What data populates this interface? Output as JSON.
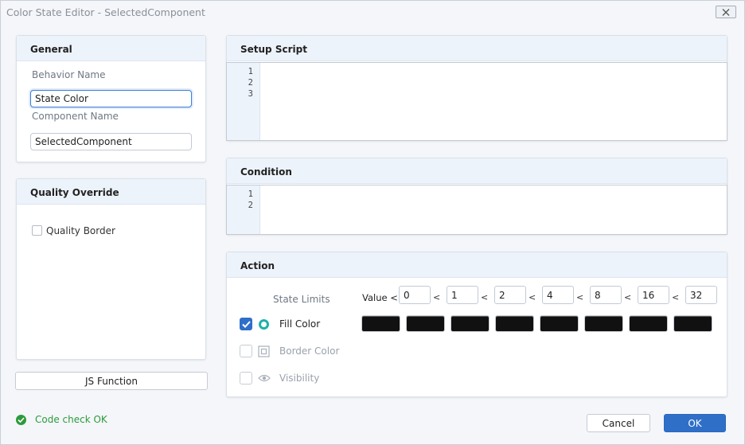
{
  "window": {
    "title": "Color State Editor - SelectedComponent"
  },
  "general": {
    "header": "General",
    "behavior_label": "Behavior Name",
    "behavior_value": "State Color",
    "component_label": "Component Name",
    "component_value": "SelectedComponent"
  },
  "quality": {
    "header": "Quality Override",
    "border_label": "Quality Border",
    "border_checked": false
  },
  "js_function": "JS Function",
  "setup": {
    "header": "Setup Script",
    "lines": [
      "1",
      "2",
      "3"
    ]
  },
  "condition": {
    "header": "Condition",
    "lines": [
      "1",
      "2"
    ]
  },
  "action": {
    "header": "Action",
    "state_limits_label": "State Limits",
    "value_prefix": "Value <",
    "separator": "<",
    "limits": [
      "0",
      "1",
      "2",
      "4",
      "8",
      "16",
      "32"
    ],
    "fill_color": {
      "label": "Fill Color",
      "checked": true,
      "icon": "ring-icon"
    },
    "border_color": {
      "label": "Border Color",
      "checked": false,
      "icon": "square-frame-icon"
    },
    "visibility": {
      "label": "Visibility",
      "checked": false,
      "icon": "eye-icon"
    },
    "swatches": [
      "#111111",
      "#111111",
      "#111111",
      "#111111",
      "#111111",
      "#111111",
      "#111111",
      "#111111"
    ]
  },
  "status": {
    "text": "Code check OK",
    "color": "#2e9a3c"
  },
  "buttons": {
    "cancel": "Cancel",
    "ok": "OK"
  },
  "colors": {
    "accent": "#2f6fc8",
    "teal": "#1fb1a6"
  }
}
